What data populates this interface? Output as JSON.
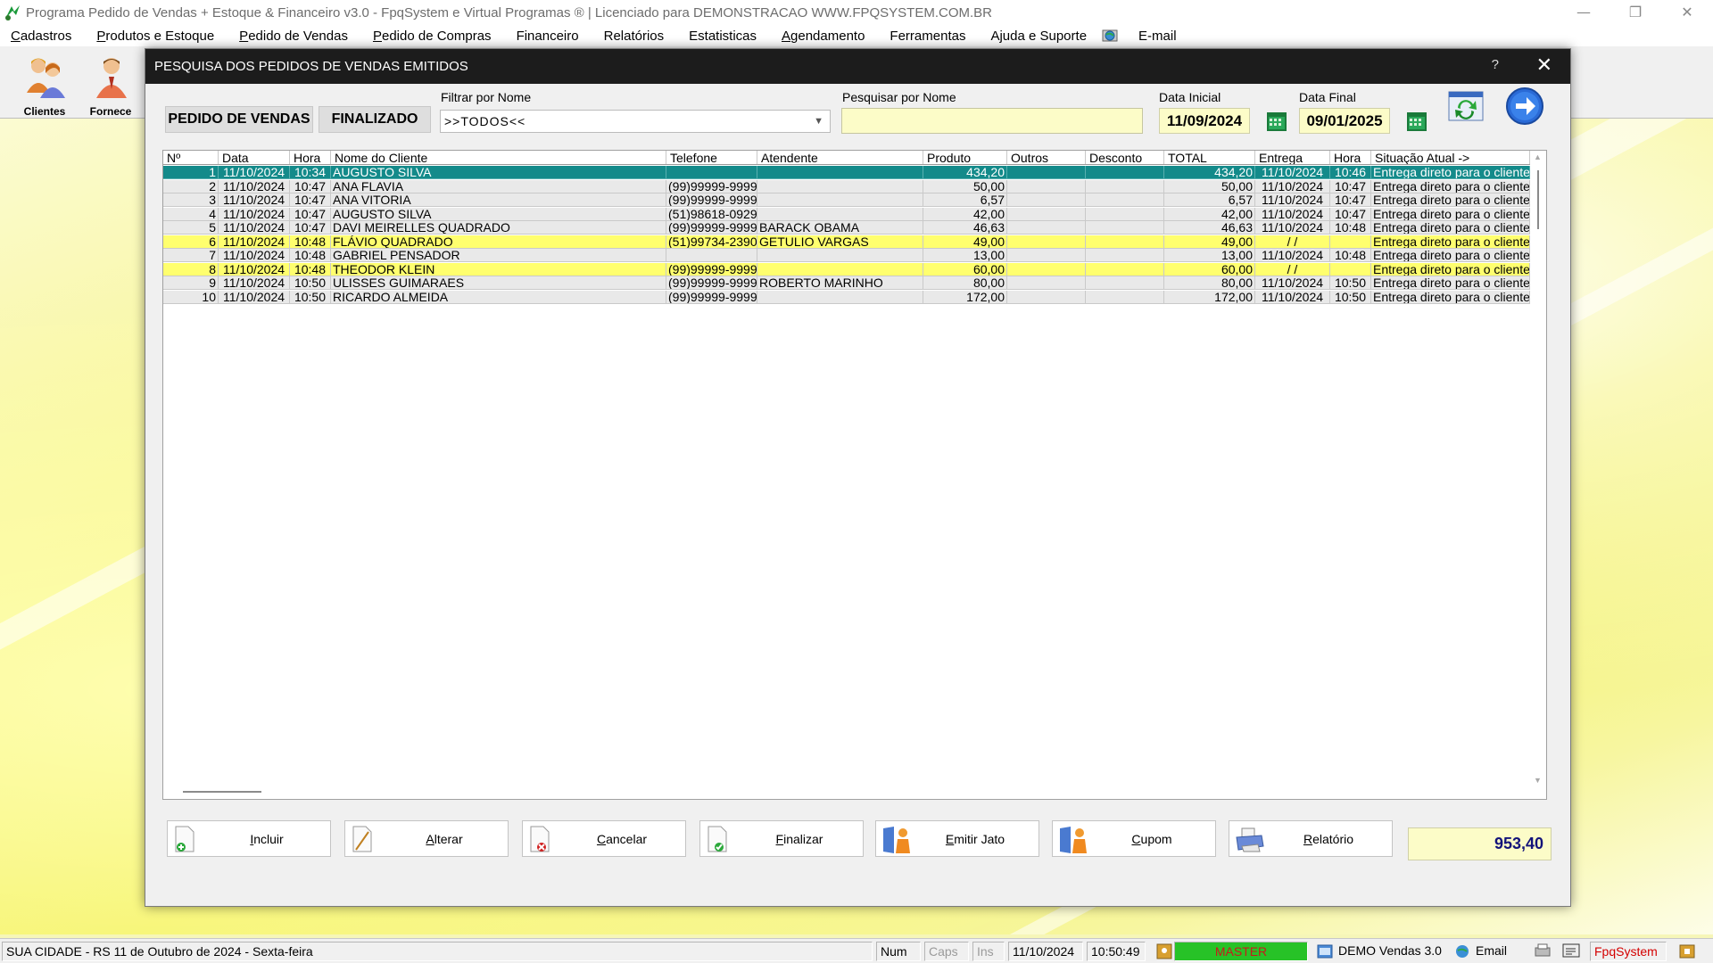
{
  "window": {
    "title": "Programa Pedido de Vendas + Estoque & Financeiro v3.0 - FpqSystem e Virtual Programas ® | Licenciado para  DEMONSTRACAO WWW.FPQSYSTEM.COM.BR",
    "controls": [
      "—",
      "❐",
      "✕"
    ]
  },
  "menu": [
    "Cadastros",
    "Produtos e Estoque",
    "Pedido de Vendas",
    "Pedido de Compras",
    "Financeiro",
    "Relatórios",
    "Estatisticas",
    "Agendamento",
    "Ferramentas",
    "Ajuda e Suporte",
    "E-mail"
  ],
  "toolbar": {
    "clientes": "Clientes",
    "fornece": "Fornece"
  },
  "dialog": {
    "title": "PESQUISA DOS PEDIDOS DE VENDAS EMITIDOS",
    "help": "?",
    "close": "✕",
    "tab_vendas": "PEDIDO DE VENDAS",
    "tab_finalizado": "FINALIZADO",
    "filter_label": "Filtrar por Nome",
    "filter_value": ">>TODOS<<",
    "search_label": "Pesquisar por Nome",
    "search_value": "",
    "date_start_label": "Data Inicial",
    "date_start": "11/09/2024",
    "date_end_label": "Data Final",
    "date_end": "09/01/2025"
  },
  "grid": {
    "columns": [
      "Nº",
      "Data",
      "Hora",
      "Nome do Cliente",
      "Telefone",
      "Atendente",
      "Produto",
      "Outros",
      "Desconto",
      "TOTAL",
      "Entrega",
      "Hora",
      "Situação Atual ->"
    ],
    "rows": [
      [
        "1",
        "11/10/2024",
        "10:34",
        "AUGUSTO SILVA",
        "",
        "",
        "434,20",
        "",
        "",
        "434,20",
        "11/10/2024",
        "10:46",
        "Entrega direto para o cliente"
      ],
      [
        "2",
        "11/10/2024",
        "10:47",
        "ANA FLAVIA",
        "(99)99999-9999",
        "",
        "50,00",
        "",
        "",
        "50,00",
        "11/10/2024",
        "10:47",
        "Entrega direto para o cliente"
      ],
      [
        "3",
        "11/10/2024",
        "10:47",
        "ANA VITORIA",
        "(99)99999-9999",
        "",
        "6,57",
        "",
        "",
        "6,57",
        "11/10/2024",
        "10:47",
        "Entrega direto para o cliente"
      ],
      [
        "4",
        "11/10/2024",
        "10:47",
        "AUGUSTO SILVA",
        "(51)98618-0929",
        "",
        "42,00",
        "",
        "",
        "42,00",
        "11/10/2024",
        "10:47",
        "Entrega direto para o cliente"
      ],
      [
        "5",
        "11/10/2024",
        "10:47",
        "DAVI MEIRELLES QUADRADO",
        "(99)99999-9999",
        "BARACK OBAMA",
        "46,63",
        "",
        "",
        "46,63",
        "11/10/2024",
        "10:48",
        "Entrega direto para o cliente"
      ],
      [
        "6",
        "11/10/2024",
        "10:48",
        "FLÁVIO QUADRADO",
        "(51)99734-2390",
        "GETULIO VARGAS",
        "49,00",
        "",
        "",
        "49,00",
        "/  /",
        "",
        "Entrega direto para o cliente"
      ],
      [
        "7",
        "11/10/2024",
        "10:48",
        "GABRIEL PENSADOR",
        "",
        "",
        "13,00",
        "",
        "",
        "13,00",
        "11/10/2024",
        "10:48",
        "Entrega direto para o cliente"
      ],
      [
        "8",
        "11/10/2024",
        "10:48",
        "THEODOR KLEIN",
        "(99)99999-9999",
        "",
        "60,00",
        "",
        "",
        "60,00",
        "/  /",
        "",
        "Entrega direto para o cliente"
      ],
      [
        "9",
        "11/10/2024",
        "10:50",
        "ULISSES GUIMARAES",
        "(99)99999-9999",
        "ROBERTO MARINHO",
        "80,00",
        "",
        "",
        "80,00",
        "11/10/2024",
        "10:50",
        "Entrega direto para o cliente"
      ],
      [
        "10",
        "11/10/2024",
        "10:50",
        "RICARDO ALMEIDA",
        "(99)99999-9999",
        "",
        "172,00",
        "",
        "",
        "172,00",
        "11/10/2024",
        "10:50",
        "Entrega direto para o cliente"
      ]
    ],
    "row_states": [
      "selected",
      "normal",
      "normal",
      "normal",
      "normal",
      "yellow",
      "normal",
      "yellow",
      "normal",
      "normal"
    ]
  },
  "actions": {
    "incluir": "Incluir",
    "alterar": "Alterar",
    "cancelar": "Cancelar",
    "finalizar": "Finalizar",
    "emitir_jato": "Emitir Jato",
    "cupom": "Cupom",
    "relatorio": "Relatório",
    "total": "953,40"
  },
  "status": {
    "location": "SUA CIDADE - RS 11 de Outubro de 2024 - Sexta-feira",
    "num": "Num",
    "caps": "Caps",
    "ins": "Ins",
    "date": "11/10/2024",
    "time": "10:50:49",
    "user": "MASTER",
    "version": "DEMO Vendas 3.0",
    "email": "Email",
    "brand": "FpqSystem"
  },
  "colors": {
    "selected_row": "#138a8a",
    "highlight_row": "#ffff6e",
    "input_bg": "#fcfcc8",
    "total_text": "#13137a",
    "master_bg": "#27c227"
  }
}
